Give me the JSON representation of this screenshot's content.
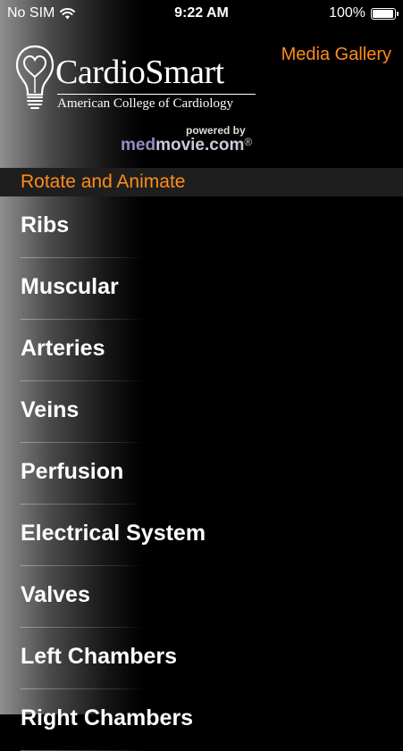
{
  "status_bar": {
    "carrier": "No SIM",
    "time": "9:22 AM",
    "battery_percent": "100%",
    "battery_level": 1.0,
    "wifi_icon": "wifi-icon"
  },
  "header": {
    "media_gallery": "Media Gallery",
    "logo_title": "CardioSmart",
    "logo_subtitle": "American College of Cardiology",
    "powered_by": "powered by",
    "brand_med": "med",
    "brand_movie": "movie.com",
    "brand_reg": "®"
  },
  "section": {
    "title": "Rotate and Animate"
  },
  "menu": {
    "items": [
      {
        "label": "Ribs"
      },
      {
        "label": "Muscular"
      },
      {
        "label": "Arteries"
      },
      {
        "label": "Veins"
      },
      {
        "label": "Perfusion"
      },
      {
        "label": "Electrical System"
      },
      {
        "label": "Valves"
      },
      {
        "label": "Left Chambers"
      },
      {
        "label": "Right Chambers"
      }
    ]
  },
  "colors": {
    "accent": "#ff8c1a",
    "background": "#000000"
  }
}
